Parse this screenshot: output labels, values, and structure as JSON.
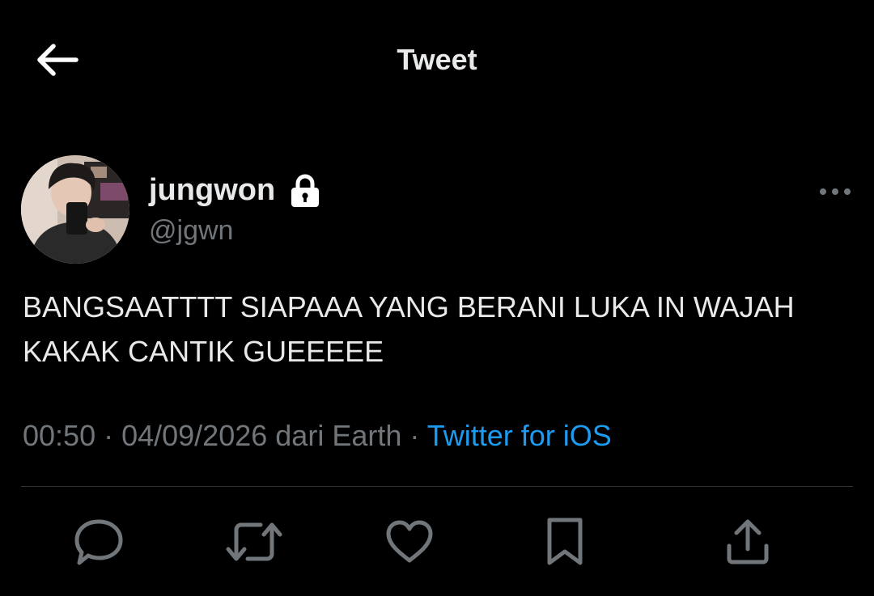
{
  "header": {
    "title": "Tweet",
    "back_icon": "arrow-left-icon"
  },
  "author": {
    "name": "jungwon",
    "handle": "@jgwn",
    "protected_icon": "lock-icon",
    "avatar_icon": "avatar-photo"
  },
  "tweet": {
    "text": "BANGSAATTTT SIAPAAA YANG BERANI LUKA IN WAJAH\nKAKAK CANTIK GUEEEEE",
    "time": "00:50",
    "separator1": " · ",
    "date": "04/09/2026",
    "location_text": " dari Earth",
    "separator2": " · ",
    "source": "Twitter for iOS"
  },
  "actions": {
    "reply_icon": "reply-icon",
    "retweet_icon": "retweet-icon",
    "like_icon": "heart-icon",
    "bookmark_icon": "bookmark-icon",
    "share_icon": "share-icon"
  },
  "colors": {
    "background": "#000000",
    "primary_text": "#e7e9ea",
    "secondary_text": "#71767b",
    "link": "#1d9bf0",
    "divider": "#2f3336"
  }
}
